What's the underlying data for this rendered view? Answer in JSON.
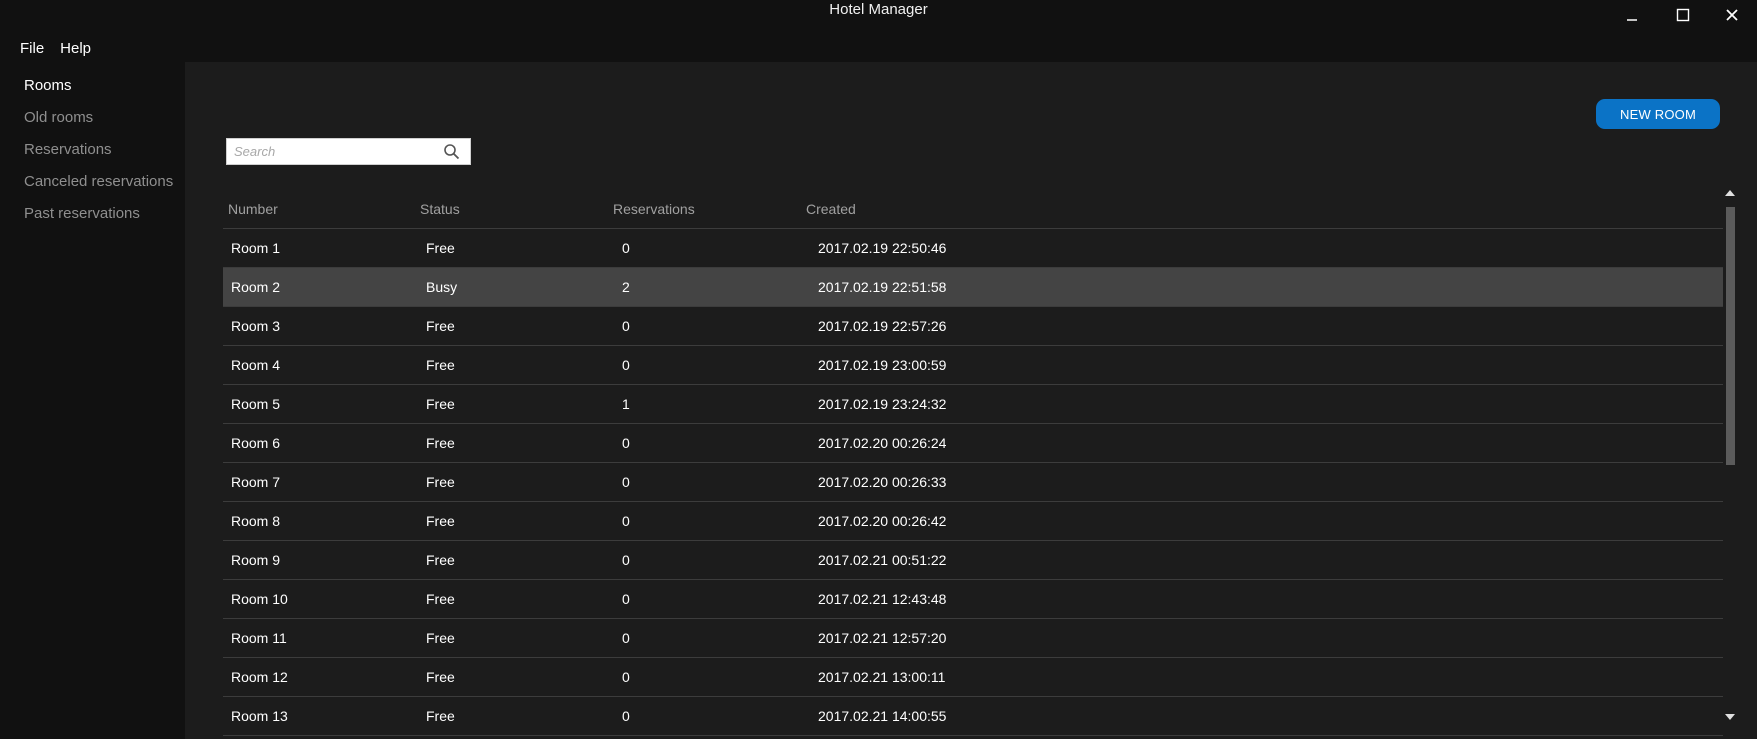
{
  "window": {
    "title": "Hotel Manager"
  },
  "menu": {
    "items": [
      {
        "label": "File"
      },
      {
        "label": "Help"
      }
    ]
  },
  "sidebar": {
    "items": [
      {
        "label": "Rooms",
        "active": true
      },
      {
        "label": "Old rooms"
      },
      {
        "label": "Reservations"
      },
      {
        "label": "Canceled reservations"
      },
      {
        "label": "Past reservations"
      }
    ]
  },
  "toolbar": {
    "new_room_label": "NEW ROOM"
  },
  "search": {
    "placeholder": "Search",
    "value": ""
  },
  "table": {
    "headers": [
      "Number",
      "Status",
      "Reservations",
      "Created"
    ],
    "selected_index": 1,
    "rows": [
      [
        "Room 1",
        "Free",
        "0",
        "2017.02.19 22:50:46"
      ],
      [
        "Room 2",
        "Busy",
        "2",
        "2017.02.19 22:51:58"
      ],
      [
        "Room 3",
        "Free",
        "0",
        "2017.02.19 22:57:26"
      ],
      [
        "Room 4",
        "Free",
        "0",
        "2017.02.19 23:00:59"
      ],
      [
        "Room 5",
        "Free",
        "1",
        "2017.02.19 23:24:32"
      ],
      [
        "Room 6",
        "Free",
        "0",
        "2017.02.20 00:26:24"
      ],
      [
        "Room 7",
        "Free",
        "0",
        "2017.02.20 00:26:33"
      ],
      [
        "Room 8",
        "Free",
        "0",
        "2017.02.20 00:26:42"
      ],
      [
        "Room 9",
        "Free",
        "0",
        "2017.02.21 00:51:22"
      ],
      [
        "Room 10",
        "Free",
        "0",
        "2017.02.21 12:43:48"
      ],
      [
        "Room 11",
        "Free",
        "0",
        "2017.02.21 12:57:20"
      ],
      [
        "Room 12",
        "Free",
        "0",
        "2017.02.21 13:00:11"
      ],
      [
        "Room 13",
        "Free",
        "0",
        "2017.02.21 14:00:55"
      ]
    ]
  },
  "colors": {
    "accent": "#0b73c6",
    "background": "#111111",
    "panel": "#1c1c1c",
    "selected_row": "#444444"
  },
  "icons": {
    "search": "magnifier-icon",
    "minimize": "minimize-icon",
    "maximize": "maximize-icon",
    "close": "close-icon"
  }
}
